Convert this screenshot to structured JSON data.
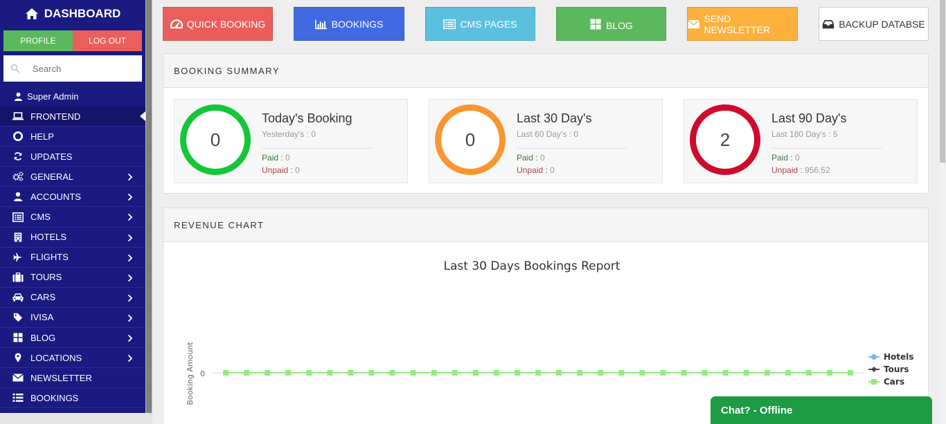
{
  "sidebar": {
    "title": "DASHBOARD",
    "profile_label": "PROFILE",
    "logout_label": "LOG OUT",
    "search_placeholder": "Search",
    "user": "Super Admin",
    "items": [
      {
        "label": "FRONTEND",
        "icon": "laptop-icon",
        "active": true
      },
      {
        "label": "HELP",
        "icon": "lifebuoy-icon"
      },
      {
        "label": "UPDATES",
        "icon": "refresh-icon"
      },
      {
        "label": "GENERAL",
        "icon": "cogs-icon",
        "submenu": true
      },
      {
        "label": "ACCOUNTS",
        "icon": "user-icon",
        "submenu": true
      },
      {
        "label": "CMS",
        "icon": "list-alt-icon",
        "submenu": true
      },
      {
        "label": "HOTELS",
        "icon": "building-icon",
        "submenu": true
      },
      {
        "label": "FLIGHTS",
        "icon": "plane-icon",
        "submenu": true
      },
      {
        "label": "TOURS",
        "icon": "suitcase-icon",
        "submenu": true
      },
      {
        "label": "CARS",
        "icon": "car-icon",
        "submenu": true
      },
      {
        "label": "IVISA",
        "icon": "tag-icon",
        "submenu": true
      },
      {
        "label": "BLOG",
        "icon": "th-large-icon",
        "submenu": true
      },
      {
        "label": "LOCATIONS",
        "icon": "map-marker-icon",
        "submenu": true
      },
      {
        "label": "NEWSLETTER",
        "icon": "envelope-icon"
      },
      {
        "label": "BOOKINGS",
        "icon": "list-icon"
      }
    ]
  },
  "quick_buttons": [
    {
      "label": "QUICK BOOKING",
      "icon": "dashboard-gauge-icon",
      "color": "#ea5f5b"
    },
    {
      "label": "BOOKINGS",
      "icon": "bar-chart-icon",
      "color": "#4169e1"
    },
    {
      "label": "CMS PAGES",
      "icon": "list-alt-icon",
      "color": "#5bc0de"
    },
    {
      "label": "BLOG",
      "icon": "th-large-icon",
      "color": "#5cb85c"
    },
    {
      "label": "SEND NEWSLETTER",
      "icon": "envelope-icon",
      "color": "#fbb13c"
    },
    {
      "label": "BACKUP DATABSE",
      "icon": "inbox-icon",
      "color": "#ffffff"
    }
  ],
  "booking_summary": {
    "heading": "BOOKING SUMMARY",
    "cards": [
      {
        "title": "Today's Booking",
        "count": "0",
        "prev": "Yesterday's : 0",
        "paid_label": "Paid :",
        "paid": "0",
        "unpaid_label": "Unpaid :",
        "unpaid": "0",
        "ring_color": "#14c63a"
      },
      {
        "title": "Last 30 Day's",
        "count": "0",
        "prev": "Last 60 Day's : 0",
        "paid_label": "Paid :",
        "paid": "0",
        "unpaid_label": "Unpaid :",
        "unpaid": "0",
        "ring_color": "#f9962f"
      },
      {
        "title": "Last 90 Day's",
        "count": "2",
        "prev": "Last 180 Day's : 5",
        "paid_label": "Paid :",
        "paid": "0",
        "unpaid_label": "Unpaid :",
        "unpaid": "956.52",
        "ring_color": "#cf0a2c"
      }
    ]
  },
  "revenue_chart": {
    "heading": "REVENUE CHART"
  },
  "chart_data": {
    "type": "line",
    "title": "Last 30 Days Bookings Report",
    "ylabel": "Booking Amount",
    "xlabel": "",
    "y_ticks": [
      "0"
    ],
    "legend_position": "right",
    "series": [
      {
        "name": "Hotels",
        "color": "#7cb5ec",
        "marker": "circle",
        "values": [
          0,
          0,
          0,
          0,
          0,
          0,
          0,
          0,
          0,
          0,
          0,
          0,
          0,
          0,
          0,
          0,
          0,
          0,
          0,
          0,
          0,
          0,
          0,
          0,
          0,
          0,
          0,
          0,
          0,
          0,
          0
        ]
      },
      {
        "name": "Tours",
        "color": "#434348",
        "marker": "diamond",
        "values": [
          0,
          0,
          0,
          0,
          0,
          0,
          0,
          0,
          0,
          0,
          0,
          0,
          0,
          0,
          0,
          0,
          0,
          0,
          0,
          0,
          0,
          0,
          0,
          0,
          0,
          0,
          0,
          0,
          0,
          0,
          0
        ]
      },
      {
        "name": "Cars",
        "color": "#90ed7d",
        "marker": "square",
        "values": [
          0,
          0,
          0,
          0,
          0,
          0,
          0,
          0,
          0,
          0,
          0,
          0,
          0,
          0,
          0,
          0,
          0,
          0,
          0,
          0,
          0,
          0,
          0,
          0,
          0,
          0,
          0,
          0,
          0,
          0,
          0
        ]
      }
    ]
  },
  "chat": {
    "label": "Chat? - Offline",
    "color": "#1d9b45"
  }
}
